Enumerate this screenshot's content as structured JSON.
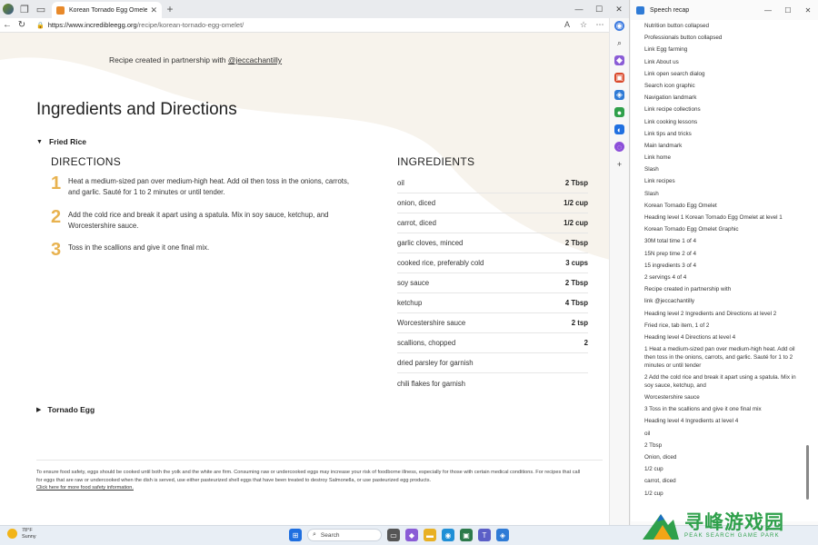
{
  "browser": {
    "tab_title": "Korean Tornado Egg Omelet - A",
    "url_domain": "https://www.incredibleegg.org",
    "url_path": "/recipe/korean-tornado-egg-omelet/"
  },
  "page": {
    "partner_text": "Recipe created in partnership with ",
    "partner_link": "@jeccachantilly",
    "heading": "Ingredients and Directions",
    "section1_label": "Fried Rice",
    "directions_heading": "DIRECTIONS",
    "steps": [
      {
        "num": "1",
        "text": "Heat a medium-sized pan over medium-high heat. Add oil then toss in the onions, carrots, and garlic. Sauté for 1 to 2 minutes or until tender."
      },
      {
        "num": "2",
        "text": "Add the cold rice and break it apart using a spatula. Mix in soy sauce, ketchup, and Worcestershire sauce."
      },
      {
        "num": "3",
        "text": "Toss in the scallions and give it one final mix."
      }
    ],
    "ingredients_heading": "INGREDIENTS",
    "ingredients": [
      {
        "name": "oil",
        "amount": "2 Tbsp"
      },
      {
        "name": "onion, diced",
        "amount": "1/2 cup"
      },
      {
        "name": "carrot, diced",
        "amount": "1/2 cup"
      },
      {
        "name": "garlic cloves, minced",
        "amount": "2 Tbsp"
      },
      {
        "name": "cooked rice, preferably cold",
        "amount": "3 cups"
      },
      {
        "name": "soy sauce",
        "amount": "2 Tbsp"
      },
      {
        "name": "ketchup",
        "amount": "4 Tbsp"
      },
      {
        "name": "Worcestershire sauce",
        "amount": "2 tsp"
      },
      {
        "name": "scallions, chopped",
        "amount": "2"
      },
      {
        "name": "dried parsley for garnish",
        "amount": ""
      },
      {
        "name": "chili flakes for garnish",
        "amount": ""
      }
    ],
    "section2_label": "Tornado Egg",
    "footnote_text": "To ensure food safety, eggs should be cooked until both the yolk and the white are firm. Consuming raw or undercooked eggs may increase your risk of foodborne illness, especially for those with certain medical conditions. For recipes that call for eggs that are raw or undercooked when the dish is served, use either pasteurized shell eggs that have been treated to destroy Salmonella, or use pasteurized egg products.",
    "footnote_link": "Click here for more food safety information."
  },
  "recap": {
    "title": "Speech recap",
    "items": [
      "Nutrition button collapsed",
      "Professionals button collapsed",
      "Link Egg farming",
      "Link About us",
      "Link open search dialog",
      "Search icon graphic",
      "Navigation landmark",
      "Link recipe collections",
      "Link cooking lessons",
      "Link tips and tricks",
      "Main landmark",
      "Link home",
      "Slash",
      "Link recipes",
      "Slash",
      "Korean Tornado Egg Omelet",
      "Heading level 1 Korean Tornado Egg Omelet at level 1",
      "Korean Tornado Egg Omelet Graphic",
      "30M total time 1 of 4",
      "15N prep time 2 of 4",
      "15 ingredients 3 of 4",
      "2 servings 4 of 4",
      "Recipe created in partnership with",
      "link @jeccachantilly",
      "Heading level 2 Ingredients and Directions at level 2",
      "Fried rice, tab item, 1 of 2",
      "Heading level 4 Directions at level 4",
      "1 Heat a medium-sized pan over medium-high heat. Add oil then toss in the onions, carrots, and garlic. Sauté for 1 to 2 minutes or until tender",
      "2 Add the cold rice and break it apart using a spatula. Mix in soy sauce, ketchup, and",
      "Worcestershire sauce",
      "3 Toss in the scallions and give it one final mix",
      "Heading level 4 Ingredients at level 4",
      "oil",
      "2 Tbsp",
      "Onion, diced",
      "1/2 cup",
      "carrot, diced",
      "1/2 cup"
    ]
  },
  "taskbar": {
    "temp": "78°F",
    "condition": "Sunny",
    "search_label": "Search"
  },
  "watermark": {
    "cn": "寻峰游戏园",
    "en": "PEAK SEARCH GAME PARK"
  },
  "colors": {
    "step_number": "#e8b24f",
    "watermark": "#2fa04b"
  }
}
